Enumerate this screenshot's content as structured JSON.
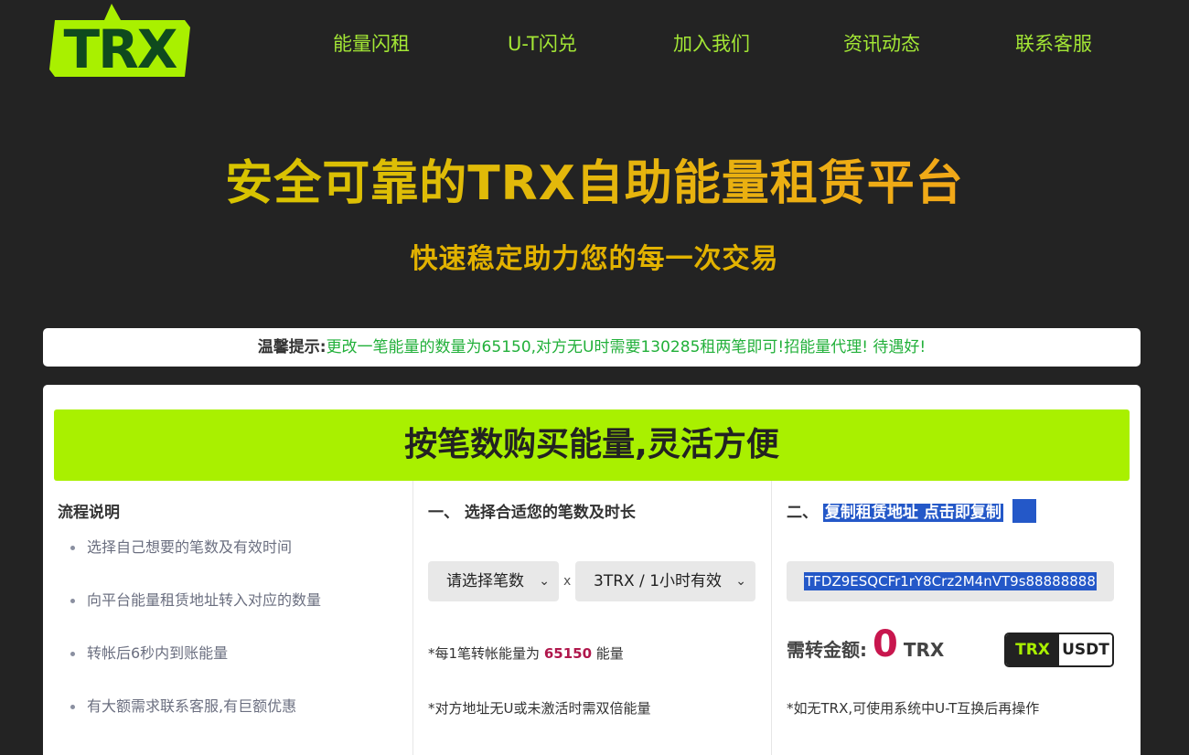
{
  "brand": {
    "logo_text": "TRX",
    "accent": "#a9f000",
    "dark": "#232323"
  },
  "nav": [
    {
      "label": "能量闪租"
    },
    {
      "label": "U-T闪兑"
    },
    {
      "label": "加入我们"
    },
    {
      "label": "资讯动态"
    },
    {
      "label": "联系客服"
    }
  ],
  "hero": {
    "title": "安全可靠的TRX自助能量租赁平台",
    "subtitle": "快速稳定助力您的每一次交易"
  },
  "notice": {
    "label": "温馨提示:",
    "message": "更改一笔能量的数量为65150,对方无U时需要130285租两笔即可!招能量代理! 待遇好!"
  },
  "banner": {
    "title": "按笔数购买能量,灵活方便"
  },
  "process": {
    "title": "流程说明",
    "steps": [
      "选择自己想要的笔数及有效时间",
      "向平台能量租赁地址转入对应的数量",
      "转帐后6秒内到账能量",
      "有大额需求联系客服,有巨额优惠"
    ]
  },
  "select_step": {
    "title": "一、 选择合适您的笔数及时长",
    "count_select": "请选择笔数",
    "times_sign": "x",
    "duration_select": "3TRX / 1小时有效",
    "note1_prefix": "*每1笔转帐能量为",
    "note1_value": "65150",
    "note1_suffix": "能量",
    "note2": "*对方地址无U或未激活时需双倍能量"
  },
  "copy_step": {
    "title_prefix": "二、",
    "title_highlight": "复制租赁地址 点击即复制",
    "address": "TFDZ9ESQCFr1rY8Crz2M4nVT9s88888888",
    "amount_label": "需转金额:",
    "amount_value": "0",
    "amount_unit": "TRX",
    "toggle_trx": "TRX",
    "toggle_usdt": "USDT",
    "note": "*如无TRX,可使用系统中U-T互换后再操作"
  }
}
